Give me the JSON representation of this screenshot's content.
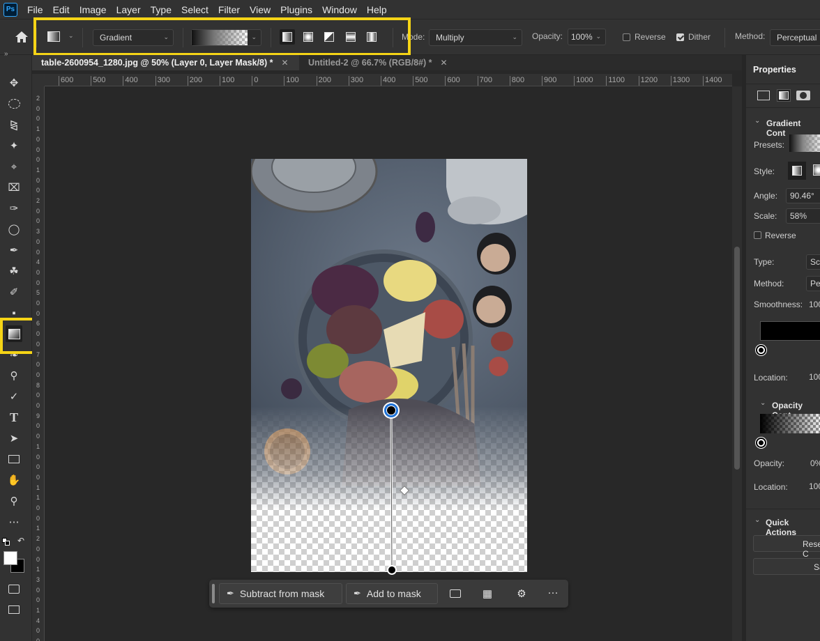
{
  "app": {
    "logo": "Ps"
  },
  "menu": [
    "File",
    "Edit",
    "Image",
    "Layer",
    "Type",
    "Select",
    "Filter",
    "View",
    "Plugins",
    "Window",
    "Help"
  ],
  "options_bar": {
    "gradient_type": "Gradient",
    "mode_label": "Mode:",
    "mode_value": "Multiply",
    "opacity_label": "Opacity:",
    "opacity_value": "100%",
    "reverse_label": "Reverse",
    "reverse_checked": false,
    "dither_label": "Dither",
    "dither_checked": true,
    "method_label": "Method:",
    "method_value": "Perceptual",
    "styles": [
      "linear-gradient-icon",
      "radial-gradient-icon",
      "angle-gradient-icon",
      "reflected-gradient-icon",
      "diamond-gradient-icon"
    ],
    "highlight_color": "#f5d416"
  },
  "tabs": [
    {
      "label": "table-2600954_1280.jpg @ 50% (Layer 0, Layer Mask/8) *",
      "active": true
    },
    {
      "label": "Untitled-2 @ 66.7% (RGB/8#) *",
      "active": false
    }
  ],
  "ruler_h": [
    "600",
    "500",
    "400",
    "300",
    "200",
    "100",
    "0",
    "100",
    "200",
    "300",
    "400",
    "500",
    "600",
    "700",
    "800",
    "900",
    "1000",
    "1100",
    "1200",
    "1300",
    "1400"
  ],
  "ruler_v": [
    "2",
    "0",
    "0",
    "1",
    "0",
    "0",
    "0",
    "1",
    "0",
    "0",
    "2",
    "0",
    "0",
    "3",
    "0",
    "0",
    "4",
    "0",
    "0",
    "5",
    "0",
    "0",
    "6",
    "0",
    "0",
    "7",
    "0",
    "0",
    "8",
    "0",
    "0",
    "9",
    "0",
    "0",
    "1",
    "0",
    "0",
    "0",
    "1",
    "1",
    "0",
    "0",
    "1",
    "2",
    "0",
    "0",
    "1",
    "3",
    "0",
    "0",
    "1",
    "4",
    "0",
    "0"
  ],
  "context_bar": {
    "subtract_label": "Subtract from mask",
    "add_label": "Add to mask",
    "more_label": "···"
  },
  "properties": {
    "title": "Properties",
    "gradient_section": "Gradient Cont",
    "presets_label": "Presets:",
    "style_label": "Style:",
    "angle_label": "Angle:",
    "angle_value": "90.46°",
    "scale_label": "Scale:",
    "scale_value": "58%",
    "reverse_label": "Reverse",
    "type_label": "Type:",
    "type_value": "Sc",
    "method_label": "Method:",
    "method_value": "Pe",
    "smoothness_label": "Smoothness:",
    "smoothness_value": "100",
    "location_label": "Location:",
    "location_value": "100",
    "opacity_section": "Opacity Cont",
    "opacity_label": "Opacity:",
    "opacity_value": "0%",
    "location2_label": "Location:",
    "location2_value": "100",
    "quick_actions": "Quick Actions",
    "reset_label": "Reset C",
    "save_label": "Sav"
  }
}
